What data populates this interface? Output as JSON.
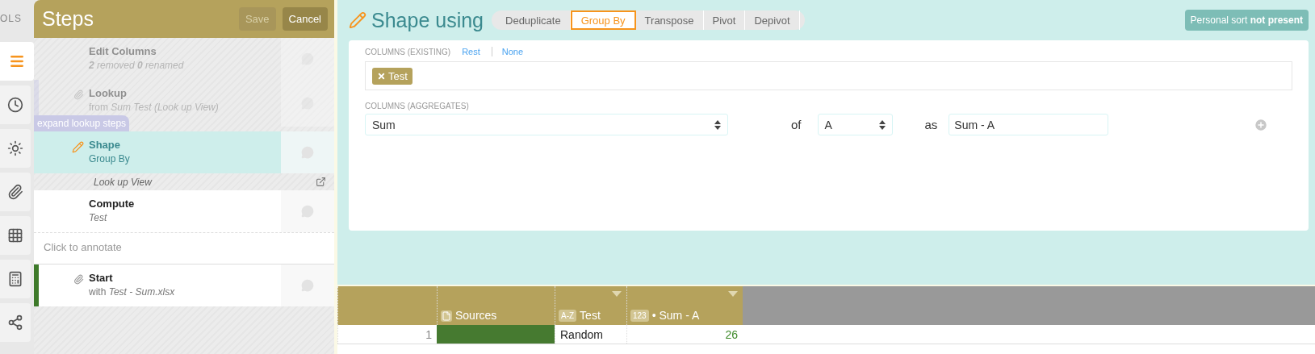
{
  "rail": {
    "label": "OLS",
    "items": [
      {
        "kind": "menu",
        "selected": true
      },
      {
        "kind": "clock",
        "selected": false
      },
      {
        "kind": "sun",
        "selected": false
      },
      {
        "kind": "clip",
        "selected": false
      },
      {
        "kind": "grid",
        "selected": false
      },
      {
        "kind": "calculator",
        "selected": false
      },
      {
        "kind": "share",
        "selected": false
      }
    ]
  },
  "steps_panel": {
    "title": "Steps",
    "buttons": [
      {
        "label": "Save",
        "disabled": true
      },
      {
        "label": "Cancel",
        "disabled": false
      }
    ],
    "steps": [
      {
        "kind": "step",
        "title": "Edit Columns",
        "subtitle": "**2** removed **0** renamed",
        "italic": true,
        "disabled": true,
        "selected": false,
        "lookup": false,
        "source": false
      },
      {
        "kind": "step",
        "title": "Lookup",
        "subtitle": "from *Sum Test (Look up View)*",
        "italic": false,
        "disabled": true,
        "selected": false,
        "lookup": true,
        "source": false
      },
      {
        "kind": "expand",
        "label": "expand lookup steps"
      },
      {
        "kind": "step",
        "title": "Shape",
        "subtitle": "Group By",
        "italic": false,
        "disabled": false,
        "selected": true,
        "lookup": false,
        "source": false
      },
      {
        "kind": "band",
        "label": "Look up View"
      },
      {
        "kind": "step",
        "title": "Compute",
        "subtitle": "Test",
        "italic": true,
        "disabled": false,
        "selected": false,
        "lookup": false,
        "source": false
      },
      {
        "kind": "annotate",
        "placeholder": "Click to annotate"
      },
      {
        "kind": "step",
        "title": "Start",
        "subtitle": "with *Test - Sum.xlsx*",
        "italic": false,
        "disabled": false,
        "selected": false,
        "lookup": false,
        "source": true
      }
    ]
  },
  "editor": {
    "title": "Shape using",
    "tabs": [
      {
        "label": "Deduplicate",
        "selected": false
      },
      {
        "label": "Group By",
        "selected": true
      },
      {
        "label": "Transpose",
        "selected": false
      },
      {
        "label": "Pivot",
        "selected": false
      },
      {
        "label": "Depivot",
        "selected": false
      }
    ],
    "sort_badge": "Personal sort **not present**",
    "existing": {
      "label": "COLUMNS (EXISTING)",
      "links": [
        "Rest",
        "None"
      ],
      "chips": [
        "Test"
      ]
    },
    "aggregates": {
      "label": "COLUMNS (AGGREGATES)",
      "function": "Sum",
      "of_label": "of",
      "column": "A",
      "as_label": "as",
      "name": "Sum - A"
    }
  },
  "table": {
    "columns_full": [
      {
        "label": "Sources",
        "kind": "file",
        "menu": false
      },
      {
        "label": "Test",
        "kind": "text",
        "badge": "A-Z",
        "menu": true
      },
      {
        "label": "• Sum - A",
        "kind": "number",
        "badge": "123",
        "menu": true
      }
    ],
    "rows": [
      {
        "index": "1",
        "cells": [
          {
            "kind": "source",
            "color": "#467a30"
          },
          {
            "kind": "text",
            "value": "Random"
          },
          {
            "kind": "number",
            "value": "26"
          }
        ]
      }
    ]
  }
}
